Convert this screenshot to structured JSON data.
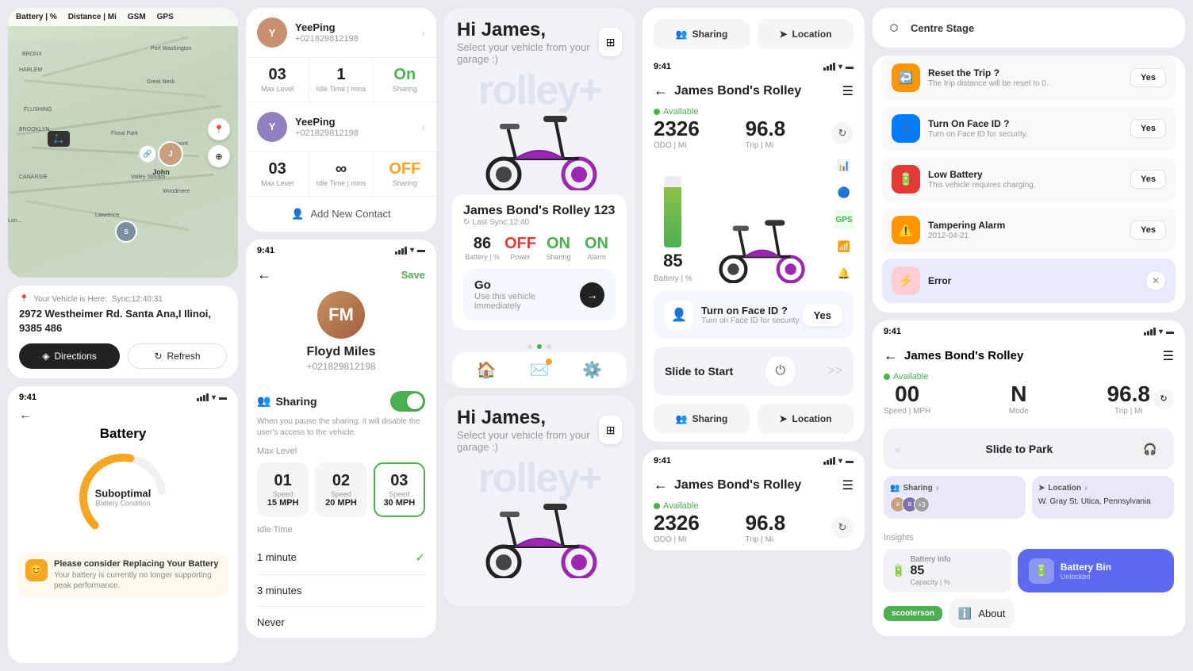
{
  "statusBar": {
    "time": "9:41",
    "signal": "●●●",
    "wifi": "wifi",
    "battery": "battery"
  },
  "col1": {
    "mapStatus": {
      "battery": {
        "label": "Battery | %",
        "value": ""
      },
      "distance": {
        "label": "Distance | Mi",
        "value": ""
      },
      "gsm": {
        "label": "GSM",
        "value": ""
      },
      "gps": {
        "label": "GPS",
        "value": ""
      }
    },
    "location": {
      "syncTime": "Sync:12:40:31",
      "vehicleHere": "Your Vehicle is Here:",
      "address": "2972 Westheimer Rd. Santa Ana,I Ilinoi, 9385 486",
      "directionsLabel": "Directions",
      "refreshLabel": "Refresh"
    },
    "battery": {
      "time": "9:41",
      "title": "Battery",
      "condition": "Suboptimal",
      "conditionSub": "Battery Condition",
      "warningTitle": "Please consider Replacing Your Battery",
      "warningDesc": "Your battery is currently no longer supporting peak performance."
    }
  },
  "col2": {
    "contacts": [
      {
        "name": "YeePing",
        "phone": "+021829812198",
        "maxLevel": "03",
        "idleTime": "1",
        "sharing": "On"
      },
      {
        "name": "YeePing",
        "phone": "+021829812198",
        "maxLevel": "03",
        "idleTime": "∞",
        "sharing": "OFF"
      }
    ],
    "addContact": "Add New Contact",
    "profile": {
      "name": "Floyd Miles",
      "phone": "+021829812198",
      "saveLabel": "Save",
      "sharingLabel": "Sharing",
      "sharingDesc": "When you pause the sharing, it will disable the user's access to the vehicle.",
      "maxLevelLabel": "Max Level",
      "speeds": [
        {
          "num": "01",
          "label": "Speed",
          "val": "15 MPH"
        },
        {
          "num": "02",
          "label": "Speed",
          "val": "20 MPH"
        },
        {
          "num": "03",
          "label": "Speed",
          "val": "30 MPH",
          "selected": true
        }
      ],
      "idleTimeLabel": "Idle Time",
      "idleOptions": [
        {
          "label": "1 minute",
          "checked": true
        },
        {
          "label": "3 minutes",
          "checked": false
        },
        {
          "label": "Never",
          "checked": false
        }
      ]
    }
  },
  "col3": {
    "hiName": "Hi James,",
    "hiSub": "Select your vehicle from your garage :)",
    "bgText": "rolley+",
    "vehicleCard": {
      "name": "James Bond's Rolley 123",
      "lastSync": "Last Sync:12:40",
      "battery": "86",
      "batteryLabel": "Battery | %",
      "power": "OFF",
      "powerLabel": "Power",
      "sharing": "ON",
      "sharingLabel": "Sharing",
      "alarm": "ON",
      "alarmLabel": "Alarm",
      "goLabel": "Go",
      "goSub": "Use this vehicle immediately"
    }
  },
  "col4": {
    "rolley": {
      "time": "9:41",
      "title": "James Bond's Rolley",
      "available": "Available",
      "odo": "2326",
      "odoLabel": "ODO | Mi",
      "trip": "96.8",
      "tripLabel": "Trip | Mi",
      "battery": "85",
      "batteryLabel": "Battery | %",
      "faceId": {
        "title": "Turn on Face ID ?",
        "desc": "Turn on Face ID for security.",
        "yesLabel": "Yes"
      },
      "slideToStart": "Slide to Start",
      "sharing": "Sharing",
      "location": "Location"
    },
    "hiName": "Hi James,",
    "hiSub": "Select your vehicle from your garage :)",
    "bgText": "rolley+",
    "rolley2": {
      "title": "James Bond's Rolley",
      "available": "Available",
      "odo": "2326",
      "odoLabel": "ODO | Mi",
      "trip": "96.8",
      "tripLabel": "Trip | Mi"
    }
  },
  "col6": {
    "centreStage": "Centre Stage",
    "notifications": [
      {
        "icon": "🔄",
        "iconBg": "orange",
        "title": "Reset the Trip ?",
        "desc": "The trip distance will be reset to 0.",
        "action": "Yes"
      },
      {
        "icon": "👤",
        "iconBg": "blue",
        "title": "Turn On Face ID ?",
        "desc": "Turn on Face ID for security.",
        "action": "Yes"
      },
      {
        "icon": "🔋",
        "iconBg": "red",
        "title": "Low Battery",
        "desc": "This vehicle requires charging.",
        "action": "Yes"
      },
      {
        "icon": "⚠️",
        "iconBg": "orange",
        "title": "Tampering Alarm",
        "desc": "2012-04-21",
        "action": "Yes"
      },
      {
        "icon": "⚡",
        "iconBg": "gray",
        "title": "Error",
        "action": "close"
      }
    ],
    "ride": {
      "time": "9:41",
      "title": "James Bond's Rolley",
      "available": "Available",
      "speed": "00",
      "speedUnit": "Speed | MPH",
      "mode": "N",
      "modeUnit": "Mode",
      "trip": "96.8",
      "tripUnit": "Trip | Mi",
      "slideToParklabel": "Slide to Park",
      "sharingTitle": "Sharing",
      "locationTitle": "Location",
      "locationAddress": "W. Gray St. Utica, Pennsylvania",
      "plusCount": "+3"
    },
    "insights": {
      "title": "Insights",
      "batteryLabel": "Battery Info",
      "capacityLabel": "Capacity | %",
      "capacityValue": "85",
      "batteryBin": {
        "label": "Battery Bin",
        "sub": "Unlocked"
      },
      "about": "About",
      "scootersonLabel": "scooterson"
    }
  }
}
